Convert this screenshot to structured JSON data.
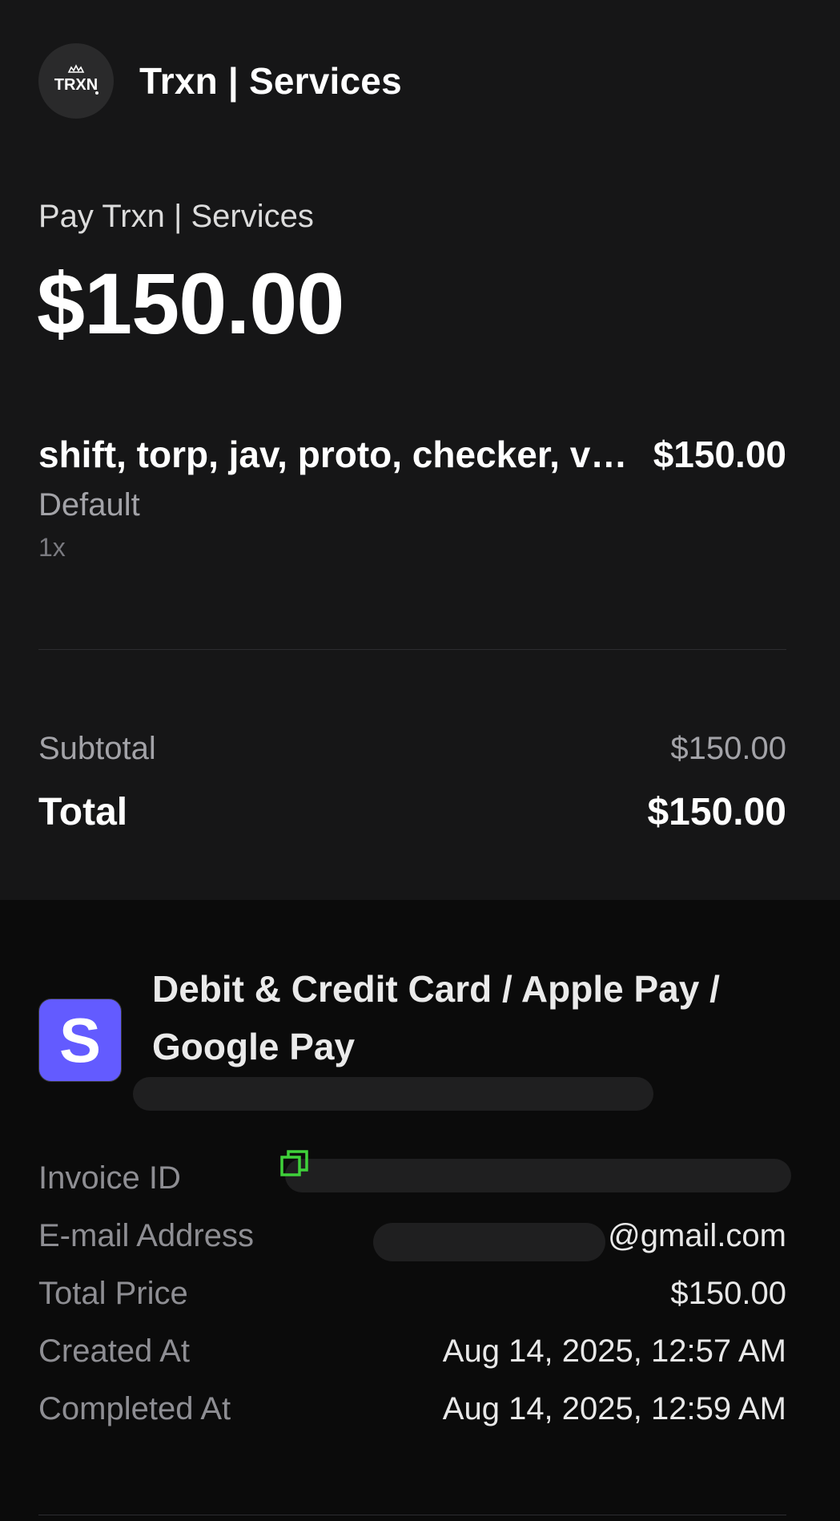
{
  "merchant": {
    "logo_text": "TRXN",
    "name": "Trxn | Services"
  },
  "payment": {
    "pay_label": "Pay Trxn | Services",
    "amount": "$150.00"
  },
  "item": {
    "name": "shift, torp, jav, proto, checker, void",
    "price": "$150.00",
    "variant": "Default",
    "quantity": "1x"
  },
  "summary": {
    "subtotal_label": "Subtotal",
    "subtotal_value": "$150.00",
    "total_label": "Total",
    "total_value": "$150.00"
  },
  "method": {
    "icon_letter": "S",
    "label": "Debit & Credit Card / Apple Pay / Google Pay"
  },
  "details": {
    "invoice_label": "Invoice ID",
    "email_label": "E-mail Address",
    "email_value_visible": "@gmail.com",
    "total_price_label": "Total Price",
    "total_price_value": "$150.00",
    "created_label": "Created At",
    "created_value": "Aug 14, 2025, 12:57 AM",
    "completed_label": "Completed At",
    "completed_value": "Aug 14, 2025, 12:59 AM"
  },
  "colors": {
    "background_top": "#161617",
    "background_bottom": "#0b0b0b",
    "stripe_brand": "#635bff",
    "copy_icon": "#3fd13a"
  },
  "icons": {
    "copy": "copy-icon",
    "stripe": "stripe-logo-icon"
  }
}
